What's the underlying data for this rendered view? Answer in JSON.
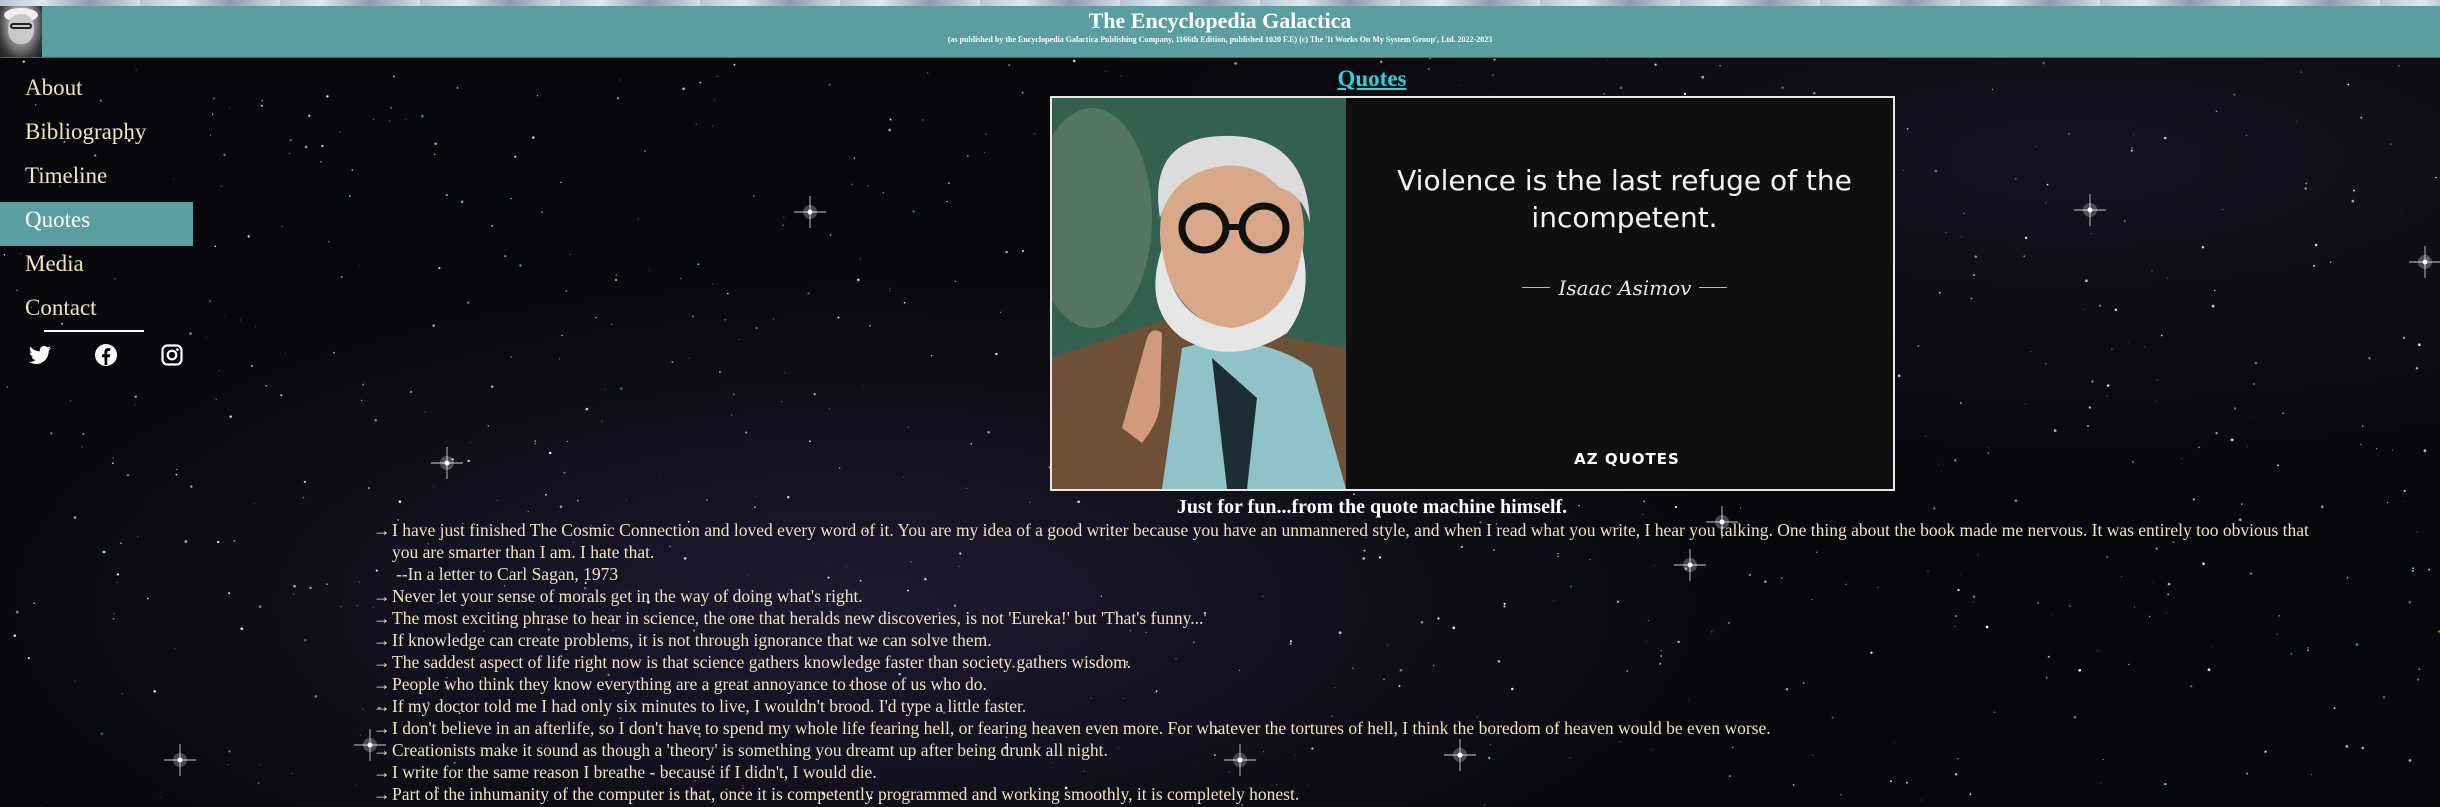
{
  "header": {
    "title": "The Encyclopedia Galactica",
    "subtitle": "(as published by the Encyclopedia Galactica Publishing Company, 1166th Edition, published 1020 F.E) (c) The 'It Works On My System Group', Ltd. 2022-2023"
  },
  "nav": {
    "items": [
      {
        "label": "About"
      },
      {
        "label": "Bibliography"
      },
      {
        "label": "Timeline"
      },
      {
        "label": "Quotes",
        "active": true
      },
      {
        "label": "Media"
      },
      {
        "label": "Contact"
      }
    ],
    "social": [
      "twitter-icon",
      "facebook-icon",
      "instagram-icon"
    ]
  },
  "main": {
    "section_title": "Quotes",
    "featured": {
      "quote": "Violence is the last refuge of the incompetent.",
      "author": "Isaac Asimov",
      "brand": "AZ QUOTES"
    },
    "fun_heading": "Just for fun...from the quote machine himself.",
    "arrow": "→",
    "quotes": [
      {
        "text": "I have just finished The Cosmic Connection and loved every word of it. You are my idea of a good writer because you have an unmannered style, and when I read what you write, I hear you talking. One thing about the book made me nervous. It was entirely too obvious that you are smarter than I am. I hate that.",
        "attribution": "--In a letter to Carl Sagan, 1973"
      },
      {
        "text": "Never let your sense of morals get in the way of doing what's right."
      },
      {
        "text": "The most exciting phrase to hear in science, the one that heralds new discoveries, is not 'Eureka!' but 'That's funny...'"
      },
      {
        "text": "If knowledge can create problems, it is not through ignorance that we can solve them."
      },
      {
        "text": "The saddest aspect of life right now is that science gathers knowledge faster than society gathers wisdom."
      },
      {
        "text": "People who think they know everything are a great annoyance to those of us who do."
      },
      {
        "text": "If my doctor told me I had only six minutes to live, I wouldn't brood. I'd type a little faster."
      },
      {
        "text": "I don't believe in an afterlife, so I don't have to spend my whole life fearing hell, or fearing heaven even more. For whatever the tortures of hell, I think the boredom of heaven would be even worse."
      },
      {
        "text": "Creationists make it sound as though a 'theory' is something you dreamt up after being drunk all night."
      },
      {
        "text": "I write for the same reason I breathe - because if I didn't, I would die."
      },
      {
        "text": "Part of the inhumanity of the computer is that, once it is competently programmed and working smoothly, it is completely honest."
      }
    ]
  },
  "colors": {
    "header_bg": "#5b9ea0",
    "nav_text": "#f2e2c2",
    "section_title": "#2ad4dd",
    "quote_text": "#f2e2c2"
  }
}
